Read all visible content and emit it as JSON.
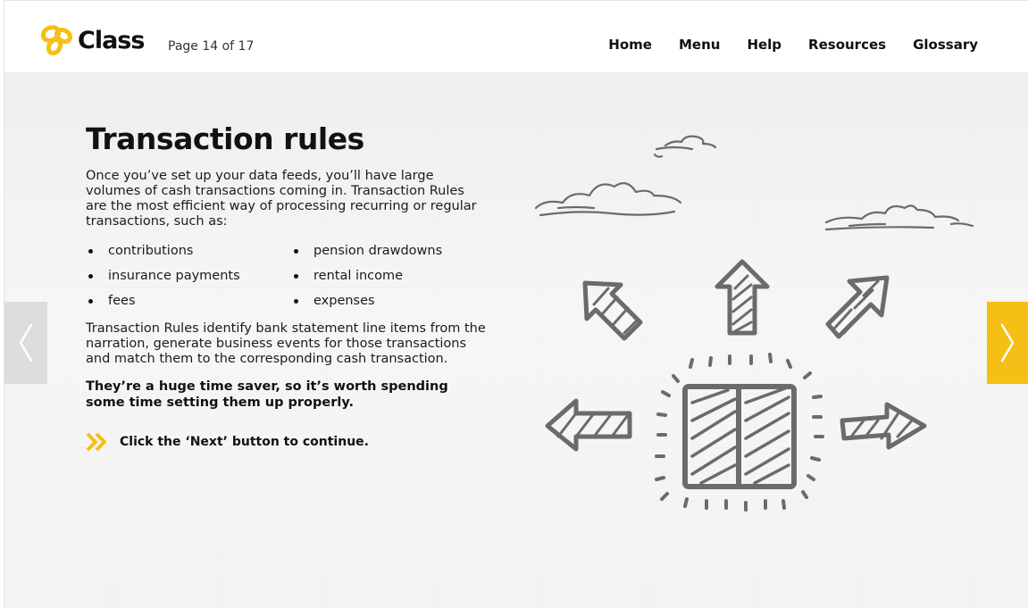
{
  "header": {
    "logo_text": "Class",
    "page_indicator": "Page 14 of 17",
    "nav": [
      "Home",
      "Menu",
      "Help",
      "Resources",
      "Glossary"
    ]
  },
  "main": {
    "title": "Transaction rules",
    "intro": "Once you’ve set up your data feeds, you’ll have large volumes of cash transactions coming in. Transaction Rules are the most efficient way of processing recurring or regular transactions, such as:",
    "bullets_left": [
      "contributions",
      "insurance payments",
      "fees"
    ],
    "bullets_right": [
      "pension drawdowns",
      "rental income",
      "expenses"
    ],
    "body": "Transaction Rules identify bank statement line items from the narration, generate business events for those transactions and match them to the corresponding cash transaction.",
    "emphasis": "They’re a huge time saver, so it’s worth spending some time setting them up properly.",
    "cta": "Click the ‘Next’ button to continue."
  },
  "icons": {
    "logo": "class-logo-icon",
    "cta": "double-chevron-right-icon",
    "prev": "chevron-left-icon",
    "next": "chevron-right-icon",
    "illustration": "sketch-arrows-illustration"
  },
  "colors": {
    "accent": "#f6bf15",
    "prev_button": "#dcdcdc",
    "sketch": "#6b6b6b"
  }
}
